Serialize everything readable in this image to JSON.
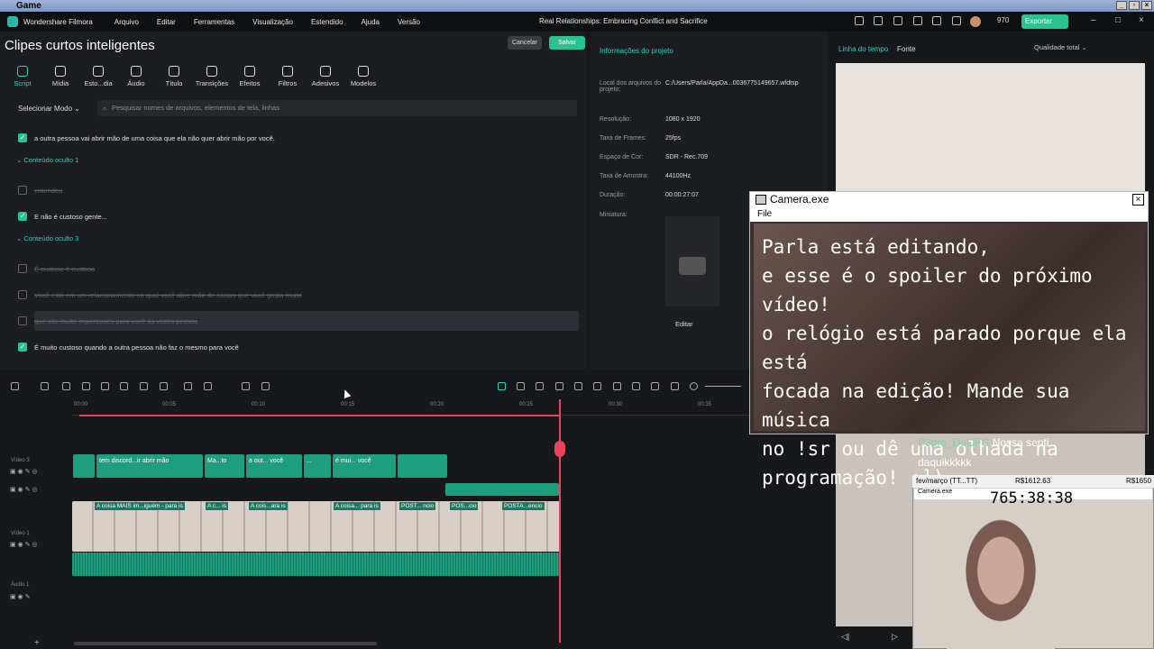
{
  "window": {
    "title": "Game"
  },
  "app": {
    "name": "Wondershare Filmora",
    "menu": [
      "Arquivo",
      "Editar",
      "Ferramentas",
      "Visualização",
      "Estendido",
      "Ajuda",
      "Versão"
    ],
    "project_title": "Real Relationships: Embracing Conflict and Sacrifice",
    "credits": "970",
    "export_label": "Exportar"
  },
  "left_panel": {
    "title": "Clipes curtos inteligentes",
    "cancel_label": "Cancelar",
    "save_label": "Salvar",
    "tools": [
      "Script",
      "Mídia",
      "Esto...dia",
      "Áudio",
      "Título",
      "Transições",
      "Efeitos",
      "Filtros",
      "Adesivos",
      "Modelos"
    ],
    "select_mode": "Selecionar Modo",
    "search_placeholder": "Pesquisar nomes de arquivos, elementos de tela, linhas",
    "rows": [
      {
        "text": "a outra pessoa vai abrir mão de uma coisa que ela não quer abrir mão por você.",
        "checked": true
      },
      {
        "group": "Conteúdo oculto 1"
      },
      {
        "text": "entendeu",
        "checked": false,
        "struck": true
      },
      {
        "text": "E não é custoso gente...",
        "checked": true
      },
      {
        "group": "Conteúdo oculto 3"
      },
      {
        "text": "É custoso é custoso",
        "checked": false,
        "struck": true
      },
      {
        "text": "Você está em um relacionamento no qual você abre mão de coisas que você gosta muito",
        "checked": false,
        "struck": true
      },
      {
        "text": "que são muito importantes para você às vezes pessoa",
        "checked": false,
        "struck": true
      },
      {
        "text": "É muito custoso quando a outra pessoa não faz o mesmo para você",
        "checked": true
      }
    ]
  },
  "project_info": {
    "title": "Informações do projeto",
    "fields": [
      {
        "k": "Local dos arquivos do projeto:",
        "v": "C:/Users/Parla/AppDa...0036775149657.wfdtsp"
      },
      {
        "k": "Resolução:",
        "v": "1080 x 1920"
      },
      {
        "k": "Taxa de Frames:",
        "v": "25fps"
      },
      {
        "k": "Espaço de Cor:",
        "v": "SDR - Rec.709"
      },
      {
        "k": "Taxa de Amostra:",
        "v": "44100Hz"
      },
      {
        "k": "Duração:",
        "v": "00:00:27:07"
      },
      {
        "k": "Miniatura:",
        "v": ""
      }
    ],
    "edit_label": "Editar"
  },
  "preview": {
    "tabs": [
      "Linha do tempo",
      "Fonte"
    ],
    "quality": "Qualidade total"
  },
  "timeline": {
    "ticks": [
      "00:00",
      "00:05",
      "00:10",
      "00:15",
      "00:20",
      "00:25",
      "00:30",
      "00:35"
    ],
    "tracks": [
      "Vídeo 3",
      "Vídeo 1",
      "Áudio 1"
    ],
    "v3_clips": [
      "tem discord...ir abrir mão",
      "Ma...to",
      "a out... você",
      "...",
      "é mui... você"
    ],
    "v1_clips": [
      "A coisa MAIS im...iguém - para is",
      "A c... is",
      "A cois...ara is",
      "A coisa... para is",
      "POST... ncio",
      "POS...cio",
      "POSTA...encio"
    ]
  },
  "overlay": {
    "camera_title": "Camera.exe",
    "camera_menu": "File",
    "camera_text": "Parla está editando,\ne esse é o spoiler do próximo vídeo!\no relógio está parado porque ela está\nfocada na edição! Mande sua música\nno !sr ou dê uma olhada na\nprogramação!  :])",
    "chat_user": "P3dro_DeOFC",
    "chat_msg": "Nossa senti",
    "chat_msg2": "daquikkkkk",
    "mini_bar": "fev/março (TT...TT)",
    "mini_amount1": "R$1612.63",
    "mini_amount2": "R$1650",
    "mini_cam_title": "Camera.exe",
    "clock": "765:38:38"
  }
}
